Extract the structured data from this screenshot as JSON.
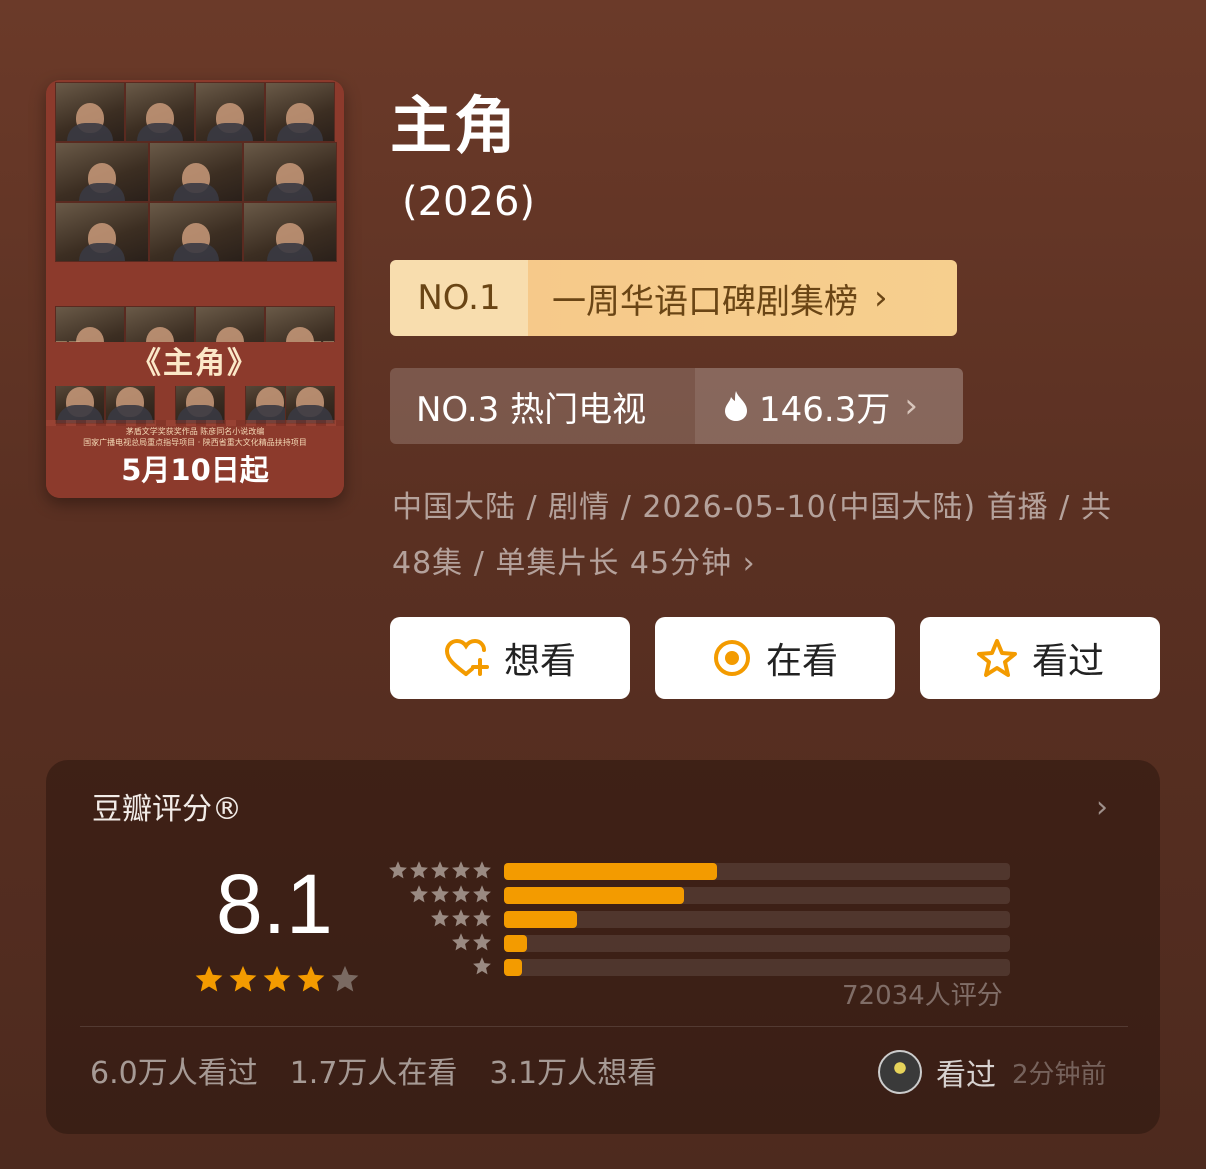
{
  "poster": {
    "title": "《主角》",
    "line1": "茅盾文学奖获奖作品 陈彦同名小说改编",
    "line2": "国家广播电视总局重点指导项目 · 陕西省重大文化精品扶持项目",
    "date": "5月10日起"
  },
  "show": {
    "title": "主角",
    "year": "(2026)"
  },
  "rank_primary": {
    "number": "NO.1",
    "label": "一周华语口碑剧集榜",
    "chevron": "›"
  },
  "rank_secondary": {
    "label": "NO.3 热门电视",
    "heat": "146.3万",
    "chevron": "›"
  },
  "meta": {
    "text": "中国大陆 / 剧情 / 2026-05-10(中国大陆) 首播 / 共 48集 / 单集片长 45分钟",
    "chevron": "›"
  },
  "actions": {
    "want": "想看",
    "watching": "在看",
    "watched": "看过"
  },
  "rating": {
    "title": "豆瓣评分®",
    "chevron": "›",
    "score": "8.1",
    "stars": 4,
    "max_stars": 5,
    "distribution": [
      {
        "stars": 5,
        "fraction": 0.42
      },
      {
        "stars": 4,
        "fraction": 0.355
      },
      {
        "stars": 3,
        "fraction": 0.145
      },
      {
        "stars": 2,
        "fraction": 0.045
      },
      {
        "stars": 1,
        "fraction": 0.035
      }
    ],
    "count_text": "72034人评分"
  },
  "stats": {
    "watched": "6.0万人看过",
    "watching": "1.7万人在看",
    "want": "3.1万人想看"
  },
  "friend": {
    "action": "看过",
    "time": "2分钟前"
  },
  "colors": {
    "accent": "#f39b00",
    "rank_gold": "#f6c98a",
    "background": "#5a3022"
  }
}
